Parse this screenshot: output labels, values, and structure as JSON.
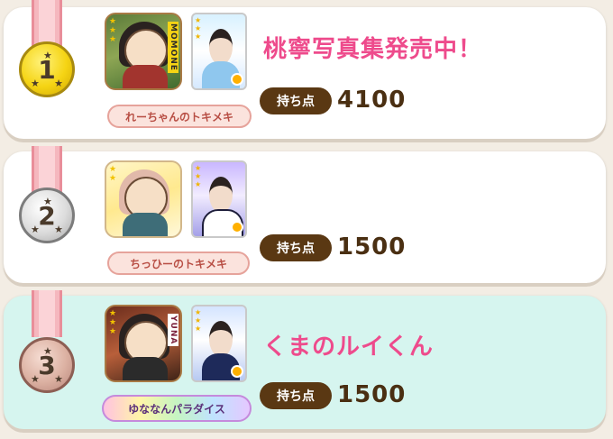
{
  "score_label": "持ち点",
  "rankings": [
    {
      "rank": "1",
      "medal": "gold",
      "avatar_tag": "MOMONE",
      "title": "れーちゃんのトキメキ",
      "headline": "桃寧写真集発売中！",
      "score": "4100"
    },
    {
      "rank": "2",
      "medal": "silver",
      "avatar_tag": "",
      "title": "ちっひーのトキメキ",
      "headline": "",
      "score": "1500"
    },
    {
      "rank": "3",
      "medal": "bronze",
      "avatar_tag": "YUNA",
      "title": "ゆななんパラダイス",
      "headline": "くまのルイくん",
      "score": "1500"
    }
  ],
  "colors": {
    "card_white": "#ffffff",
    "card_mint": "#d6f5ef",
    "headline": "#ee4b8c",
    "score_label_bg": "#5a3813",
    "score_value": "#4a2f12"
  }
}
